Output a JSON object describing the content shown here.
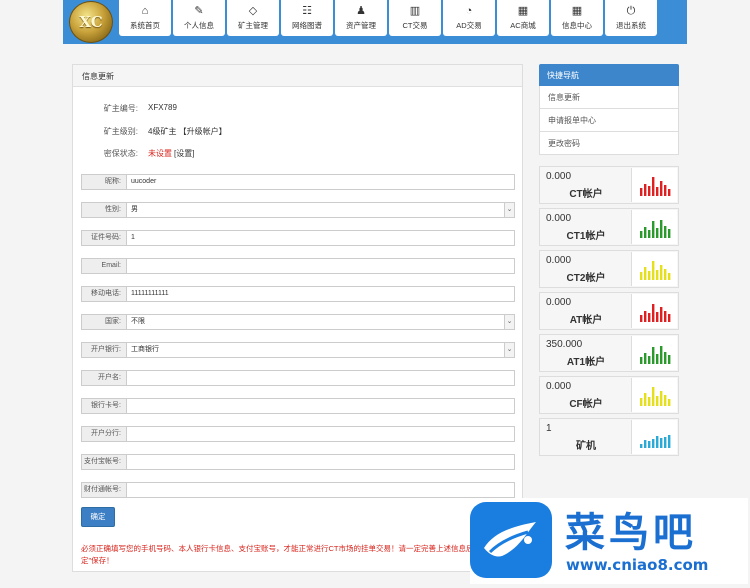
{
  "header": {
    "logo_text": "XC",
    "nav": [
      {
        "label": "系统首页",
        "icon": "⌂",
        "icon_name": "home-icon"
      },
      {
        "label": "个人信息",
        "icon": "✎",
        "icon_name": "edit-icon"
      },
      {
        "label": "矿主管理",
        "icon": "◇",
        "icon_name": "diamond-icon"
      },
      {
        "label": "网络图谱",
        "icon": "☷",
        "icon_name": "users-icon"
      },
      {
        "label": "资产管理",
        "icon": "♟",
        "icon_name": "user-icon"
      },
      {
        "label": "CT交易",
        "icon": "▥",
        "icon_name": "bar-chart-icon"
      },
      {
        "label": "AD交易",
        "icon": "◔",
        "icon_name": "dashboard-icon"
      },
      {
        "label": "AC商城",
        "icon": "▦",
        "icon_name": "calendar-icon"
      },
      {
        "label": "信息中心",
        "icon": "▦",
        "icon_name": "calendar-icon"
      },
      {
        "label": "退出系统",
        "icon": "⏻",
        "icon_name": "power-icon"
      }
    ]
  },
  "main": {
    "title": "信息更新",
    "info": {
      "id_label": "矿主编号:",
      "id_value": "XFX789",
      "level_label": "矿主级别:",
      "level_value": "4级矿主 【升级帐户】",
      "secure_label": "密保状态:",
      "secure_value": "未设置",
      "secure_link": "[设置]"
    },
    "fields": [
      {
        "label": "昵称:",
        "value": "uucoder",
        "select": false
      },
      {
        "label": "性别:",
        "value": "男",
        "select": true
      },
      {
        "label": "证件号码:",
        "value": "1",
        "select": false
      },
      {
        "label": "Email:",
        "value": "",
        "select": false
      },
      {
        "label": "移动电话:",
        "value": "11111111111",
        "select": false
      },
      {
        "label": "国家:",
        "value": "不限",
        "select": true
      },
      {
        "label": "开户银行:",
        "value": "工商银行",
        "select": true
      },
      {
        "label": "开户名:",
        "value": "",
        "select": false
      },
      {
        "label": "银行卡号:",
        "value": "",
        "select": false
      },
      {
        "label": "开户分行:",
        "value": "",
        "select": false
      },
      {
        "label": "支付宝帐号:",
        "value": "",
        "select": false
      },
      {
        "label": "财付通帐号:",
        "value": "",
        "select": false
      }
    ],
    "submit_label": "确定",
    "notice": "必须正确填写您的手机号码、本人银行卡信息、支付宝账号，才能正常进行CT市场的挂单交易！请一定完善上述信息后，点击\"确定\"保存！"
  },
  "quick_nav": {
    "title": "快捷导航",
    "items": [
      "信息更新",
      "申请报单中心",
      "更改密码"
    ]
  },
  "accounts": [
    {
      "value": "0.000",
      "name": "CT帐户",
      "color": "#e02020",
      "bars": [
        0.35,
        0.55,
        0.45,
        0.85,
        0.4,
        0.7,
        0.5,
        0.3
      ]
    },
    {
      "value": "0.000",
      "name": "CT1帐户",
      "color": "#2a9a2a",
      "bars": [
        0.3,
        0.5,
        0.35,
        0.75,
        0.45,
        0.8,
        0.55,
        0.4
      ]
    },
    {
      "value": "0.000",
      "name": "CT2帐户",
      "color": "#e6e01a",
      "bars": [
        0.35,
        0.6,
        0.4,
        0.85,
        0.45,
        0.7,
        0.5,
        0.3
      ]
    },
    {
      "value": "0.000",
      "name": "AT帐户",
      "color": "#e02020",
      "bars": [
        0.3,
        0.5,
        0.4,
        0.8,
        0.45,
        0.7,
        0.5,
        0.35
      ]
    },
    {
      "value": "350.000",
      "name": "AT1帐户",
      "color": "#2a9a2a",
      "bars": [
        0.3,
        0.5,
        0.35,
        0.75,
        0.45,
        0.8,
        0.55,
        0.4
      ]
    },
    {
      "value": "0.000",
      "name": "CF帐户",
      "color": "#e6e01a",
      "bars": [
        0.35,
        0.6,
        0.4,
        0.85,
        0.45,
        0.7,
        0.5,
        0.3
      ]
    },
    {
      "value": "1",
      "name": "矿机",
      "color": "#2aaad6",
      "bars": [
        0.2,
        0.35,
        0.3,
        0.4,
        0.55,
        0.45,
        0.5,
        0.6
      ]
    }
  ],
  "watermark": {
    "text": "菜鸟吧",
    "url": "www.cniao8.com"
  }
}
